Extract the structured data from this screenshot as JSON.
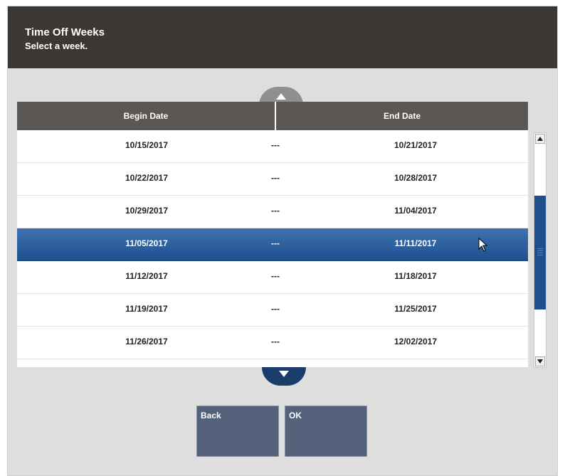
{
  "header": {
    "title": "Time Off Weeks",
    "subtitle": "Select a week."
  },
  "table": {
    "columns": [
      "Begin Date",
      "End Date"
    ],
    "separator": "---",
    "rows": [
      {
        "begin": "10/15/2017",
        "end": "10/21/2017",
        "selected": false
      },
      {
        "begin": "10/22/2017",
        "end": "10/28/2017",
        "selected": false
      },
      {
        "begin": "10/29/2017",
        "end": "11/04/2017",
        "selected": false
      },
      {
        "begin": "11/05/2017",
        "end": "11/11/2017",
        "selected": true
      },
      {
        "begin": "11/12/2017",
        "end": "11/18/2017",
        "selected": false
      },
      {
        "begin": "11/19/2017",
        "end": "11/25/2017",
        "selected": false
      },
      {
        "begin": "11/26/2017",
        "end": "12/02/2017",
        "selected": false
      }
    ]
  },
  "buttons": {
    "back": "Back",
    "ok": "OK"
  },
  "icons": {
    "scroll_up": "chevron-up-icon",
    "scroll_down": "chevron-down-icon",
    "cursor": "mouse-pointer-icon"
  },
  "colors": {
    "header_bg": "#3b3733",
    "table_header_bg": "#5a5755",
    "selection": "#1f4f8d",
    "button_bg": "#53627a",
    "frame_bg": "#dedede"
  }
}
